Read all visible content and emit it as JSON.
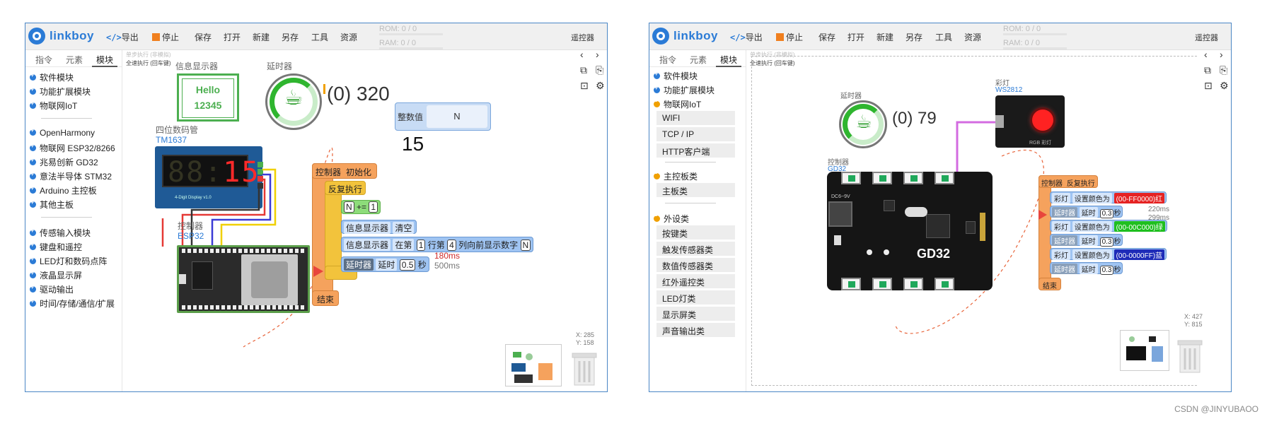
{
  "left": {
    "toolbar": {
      "logo": "linkboy",
      "export_icon": "</>",
      "export": "导出",
      "stop": "停止",
      "save": "保存",
      "open": "打开",
      "new": "新建",
      "save_as": "另存",
      "tools": "工具",
      "resources": "资源",
      "rom": "ROM: 0 / 0",
      "ram": "RAM: 0 / 0",
      "remote": "遥控器"
    },
    "sidebar": {
      "tabs": [
        "指令",
        "元素",
        "模块"
      ],
      "groups1": [
        "软件模块",
        "功能扩展模块",
        "物联网IoT"
      ],
      "boards": [
        "OpenHarmony",
        "物联网 ESP32/8266",
        "兆易创新 GD32",
        "意法半导体 STM32",
        "Arduino 主控板",
        "其他主板"
      ],
      "peripherals": [
        "传感输入模块",
        "键盘和遥控",
        "LED灯和数码点阵",
        "液晶显示屏",
        "驱动输出",
        "时间/存储/通信/扩展"
      ]
    },
    "canvas": {
      "exec_note": "单步执行 (非模拟)",
      "exec_note2": "全速执行 (回车键)",
      "info_display_label": "信息显示器",
      "hello_line1": "Hello",
      "hello_line2": "12345",
      "timer_label": "延时器",
      "timer_value": "(0) 320",
      "int_label": "整数值",
      "int_value": "N",
      "int_display": "15",
      "seg_label": "四位数码管",
      "seg_model": "TM1637",
      "seg_digits_dark": "88:",
      "seg_digits_red": "15",
      "seg_caption": "4-Digit Display   v1.0",
      "ctrl_label": "控制器",
      "ctrl_model": "ESP32",
      "coords_x": "X: 285",
      "coords_y": "Y: 158"
    },
    "blocks": {
      "init_a": "控制器",
      "init_b": "初始化",
      "loop": "反复执行",
      "n": "N",
      "plus_eq": "+=",
      "one": "1",
      "disp_clear_a": "信息显示器",
      "disp_clear_b": "清空",
      "disp_show_a": "信息显示器",
      "disp_show_b": "在第",
      "disp_show_row": "1",
      "disp_show_c": "行第",
      "disp_show_col": "4",
      "disp_show_d": "列向前显示数字",
      "disp_show_n": "N",
      "delay_a": "延时器",
      "delay_b": "延时",
      "delay_val": "0.5",
      "delay_unit": "秒",
      "note_red": "180ms",
      "note_grey": "500ms",
      "end": "结束"
    }
  },
  "right": {
    "toolbar": {
      "logo": "linkboy",
      "export_icon": "</>",
      "export": "导出",
      "stop": "停止",
      "save": "保存",
      "open": "打开",
      "new": "新建",
      "save_as": "另存",
      "tools": "工具",
      "resources": "资源",
      "rom": "ROM: 0 / 0",
      "ram": "RAM: 0 / 0",
      "remote": "遥控器"
    },
    "sidebar": {
      "tabs": [
        "指令",
        "元素",
        "模块"
      ],
      "group_software": "软件模块",
      "group_ext": "功能扩展模块",
      "group_iot": "物联网IoT",
      "iot_items": [
        "WIFI",
        "TCP / IP",
        "HTTP客户端"
      ],
      "group_main": "主控板类",
      "main_items": [
        "主板类"
      ],
      "group_peri": "外设类",
      "peri_items": [
        "按键类",
        "触发传感器类",
        "数值传感器类",
        "红外遥控类",
        "LED灯类",
        "显示屏类",
        "声音输出类"
      ]
    },
    "canvas": {
      "exec_note": "单步执行 (非模拟)",
      "exec_note2": "全速执行 (回车键)",
      "timer_label": "延时器",
      "timer_value": "(0) 79",
      "rgb_label": "彩灯",
      "rgb_model": "WS2812",
      "rgb_caption": "RGB 彩灯",
      "ctrl_label": "控制器",
      "ctrl_model": "GD32",
      "board_text": "GD32",
      "board_dc": "DC6~9V",
      "coords_x": "X: 427",
      "coords_y": "Y: 815"
    },
    "blocks": {
      "head_a": "控制器",
      "head_b": "反复执行",
      "rows": [
        {
          "a": "彩灯",
          "b": "设置颜色为",
          "v": "(00-FF0000)红",
          "color": "red"
        },
        {
          "a": "延时器",
          "b": "延时",
          "v": "0.3",
          "u": "秒"
        },
        {
          "a": "彩灯",
          "b": "设置颜色为",
          "v": "(00-00C000)绿",
          "color": "green"
        },
        {
          "a": "延时器",
          "b": "延时",
          "v": "0.3",
          "u": "秒"
        },
        {
          "a": "彩灯",
          "b": "设置颜色为",
          "v": "(00-0000FF)蓝",
          "color": "navy"
        },
        {
          "a": "延时器",
          "b": "延时",
          "v": "0.3",
          "u": "秒"
        }
      ],
      "note_1": "220ms",
      "note_2": "299ms",
      "end": "结束"
    }
  },
  "watermark": "CSDN @JINYUBAOO"
}
